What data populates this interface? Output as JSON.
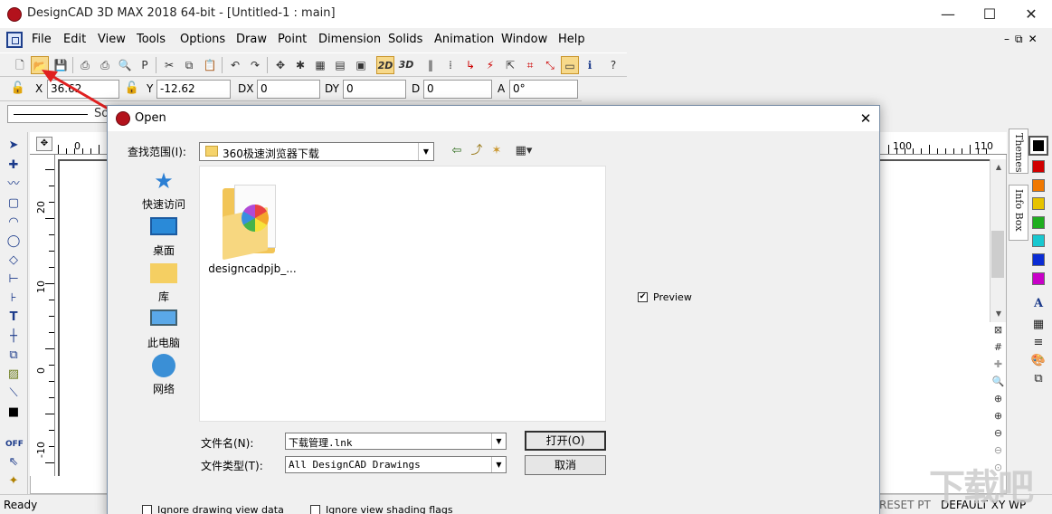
{
  "window": {
    "title": "DesignCAD 3D MAX 2018 64-bit - [Untitled-1 : main]",
    "minimize": "—",
    "maximize": "☐",
    "close": "✕"
  },
  "menu": {
    "items": [
      "File",
      "Edit",
      "View",
      "Tools",
      "Options",
      "Draw",
      "Point",
      "Dimension",
      "Solids",
      "Animation",
      "Window",
      "Help"
    ],
    "mdi_controls": "–⧉✕"
  },
  "toolbar": {
    "mode_2d": "2D",
    "mode_3d": "3D"
  },
  "coords": {
    "x_label": "X",
    "x_value": "36.62",
    "y_label": "Y",
    "y_value": "-12.62",
    "dx_label": "DX",
    "dx_value": "0",
    "dy_label": "DY",
    "dy_value": "0",
    "d_label": "D",
    "d_value": "0",
    "a_label": "A",
    "a_value": "0°"
  },
  "stylebar": {
    "truncated_label": "So"
  },
  "ruler": {
    "top_labels": [
      "0",
      "100",
      "110"
    ],
    "left_labels": [
      "20",
      "10",
      "0",
      "-10"
    ],
    "corner": "✥"
  },
  "side_tabs": {
    "themes": "Themes",
    "info_box": "Info Box"
  },
  "palette": {
    "colors": [
      "#d00000",
      "#f07800",
      "#e6c300",
      "#1fae1f",
      "#18c8d0",
      "#0a2cd4",
      "#c800c8"
    ]
  },
  "status": {
    "text": "Ready",
    "snap": "RESET PT",
    "view": "DEFAULT XY WP"
  },
  "watermark": {
    "text": "下载吧"
  },
  "dialog": {
    "title": "Open",
    "close": "✕",
    "lookin_label": "查找范围(I):",
    "lookin_value": "360极速浏览器下载",
    "places": [
      {
        "label": "快速访问"
      },
      {
        "label": "桌面"
      },
      {
        "label": "库"
      },
      {
        "label": "此电脑"
      },
      {
        "label": "网络"
      }
    ],
    "files": [
      {
        "name": "designcadpjb_..."
      }
    ],
    "preview_label": "Preview",
    "filename_label": "文件名(N):",
    "filename_value": "下载管理.lnk",
    "filetype_label": "文件类型(T):",
    "filetype_value": "All DesignCAD Drawings",
    "open_button": "打开(O)",
    "cancel_button": "取消",
    "option_ignore_view": "Ignore drawing view data",
    "option_ignore_shading": "Ignore view shading flags"
  }
}
